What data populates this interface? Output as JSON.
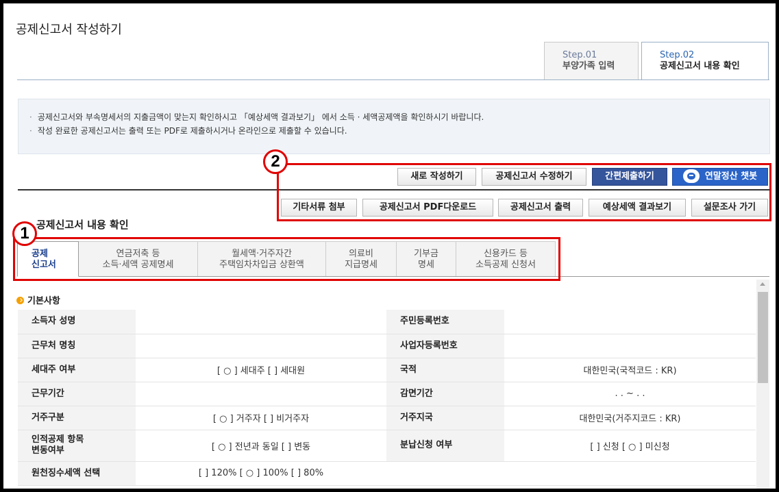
{
  "page": {
    "title": "공제신고서 작성하기"
  },
  "steps": [
    {
      "num": "Step.01",
      "label": "부양가족 입력"
    },
    {
      "num": "Step.02",
      "label": "공제신고서 내용 확인"
    }
  ],
  "info": [
    "공제신고서와 부속명세서의 지출금액이 맞는지 확인하시고 「예상세액 결과보기」 에서 소득 · 세액공제액을 확인하시기 바랍니다.",
    "작성 완료한 공제신고서는 출력 또는 PDF로 제출하시거나 온라인으로 제출할 수 있습니다."
  ],
  "actions_row1": {
    "new": "새로 작성하기",
    "edit": "공제신고서 수정하기",
    "simple_submit": "간편제출하기",
    "chatbot": "연말정산 챗봇"
  },
  "actions_row2": {
    "attach": "기타서류 첨부",
    "pdf": "공제신고서 PDF다운로드",
    "print": "공제신고서 출력",
    "estimate": "예상세액 결과보기",
    "survey": "설문조사 가기"
  },
  "badges": {
    "one": "1",
    "two": "2"
  },
  "section_title": "공제신고서 내용 확인",
  "tabs": [
    {
      "l1": "공제",
      "l2": "신고서"
    },
    {
      "l1": "연금저축 등",
      "l2": "소득·세액 공제명세"
    },
    {
      "l1": "월세액·거주자간",
      "l2": "주택임차차입금 상환액"
    },
    {
      "l1": "의료비",
      "l2": "지급명세"
    },
    {
      "l1": "기부금",
      "l2": "명세"
    },
    {
      "l1": "신용카드 등",
      "l2": "소득공제 신청서"
    }
  ],
  "basic": {
    "heading": "기본사항",
    "rows": [
      {
        "l1": "소득자 성명",
        "v1": "",
        "l2": "주민등록번호",
        "v2": ""
      },
      {
        "l1": "근무처 명칭",
        "v1": "",
        "l2": "사업자등록번호",
        "v2": ""
      },
      {
        "l1": "세대주 여부",
        "v1": "[ ○ ] 세대주 [   ] 세대원",
        "l2": "국적",
        "v2": "대한민국(국적코드 : KR)"
      },
      {
        "l1": "근무기간",
        "v1": "",
        "l2": "감면기간",
        "v2": ". . ~ . ."
      },
      {
        "l1": "거주구분",
        "v1": "[ ○ ] 거주자 [   ] 비거주자",
        "l2": "거주지국",
        "v2": "대한민국(거주지코드 : KR)"
      },
      {
        "l1": "인적공제 항목",
        "l1b": "변동여부",
        "v1": "[ ○ ] 전년과 동일 [   ] 변동",
        "l2": "분납신청 여부",
        "v2": "[   ] 신청 [ ○ ] 미신청"
      },
      {
        "l1": "원천징수세액 선택",
        "v1": "[    ] 120% [ ○ ] 100% [   ] 80%",
        "l2": "",
        "v2": ""
      }
    ]
  },
  "colors": {
    "accent_red": "#e00000",
    "button_dark": "#34549b",
    "button_blue": "#2a64c8",
    "tab_active_text": "#1a3e8c"
  }
}
